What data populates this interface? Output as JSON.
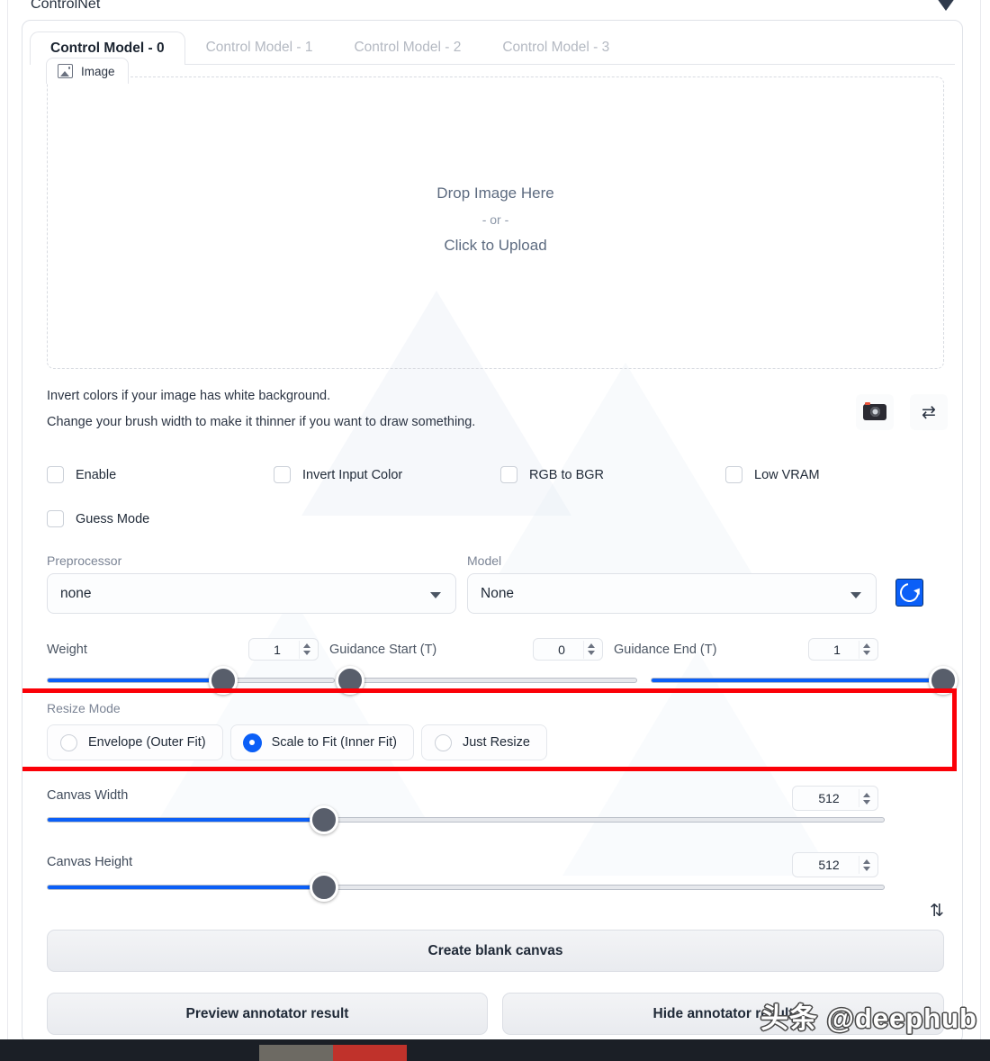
{
  "accordion": {
    "title": "ControlNet",
    "collapse_icon": "triangle-down-icon"
  },
  "tabs": [
    {
      "label": "Control Model - 0",
      "active": true
    },
    {
      "label": "Control Model - 1",
      "active": false
    },
    {
      "label": "Control Model - 2",
      "active": false
    },
    {
      "label": "Control Model - 3",
      "active": false
    }
  ],
  "image_panel": {
    "chip_label": "Image",
    "chip_icon": "image-icon",
    "drop_line1": "Drop Image Here",
    "drop_line2": "- or -",
    "drop_line3": "Click to Upload"
  },
  "hints": {
    "line1": "Invert colors if your image has white background.",
    "line2": "Change your brush width to make it thinner if you want to draw something."
  },
  "icon_buttons": {
    "webcam": "camera-icon",
    "mirror": "swap-horizontal-icon",
    "refresh": "refresh-icon",
    "swap_wh": "swap-vertical-icon",
    "swap_wh_glyph": "⇅",
    "mirror_glyph": "⇄"
  },
  "checkboxes": [
    {
      "label": "Enable",
      "checked": false
    },
    {
      "label": "Invert Input Color",
      "checked": false
    },
    {
      "label": "RGB to BGR",
      "checked": false
    },
    {
      "label": "Low VRAM",
      "checked": false
    },
    {
      "label": "Guess Mode",
      "checked": false
    }
  ],
  "dropdowns": [
    {
      "label": "Preprocessor",
      "value": "none"
    },
    {
      "label": "Model",
      "value": "None"
    }
  ],
  "sliders_row": [
    {
      "label": "Weight",
      "value": "1",
      "percent": 25
    },
    {
      "label": "Guidance Start (T)",
      "value": "0",
      "percent": 0
    },
    {
      "label": "Guidance End (T)",
      "value": "1",
      "percent": 100
    }
  ],
  "resize_mode": {
    "label": "Resize Mode",
    "highlight_color": "#fb0007",
    "options": [
      {
        "label": "Envelope (Outer Fit)",
        "selected": false
      },
      {
        "label": "Scale to Fit (Inner Fit)",
        "selected": true
      },
      {
        "label": "Just Resize",
        "selected": false
      }
    ]
  },
  "canvas": {
    "width": {
      "label": "Canvas Width",
      "value": "512",
      "percent": 33
    },
    "height": {
      "label": "Canvas Height",
      "value": "512",
      "percent": 33
    }
  },
  "buttons": {
    "create_blank_canvas": "Create blank canvas",
    "preview_annotator": "Preview annotator result",
    "hide_annotator": "Hide annotator result"
  },
  "watermark": "头条 @deephub",
  "accent_color": "#0b5ff7"
}
